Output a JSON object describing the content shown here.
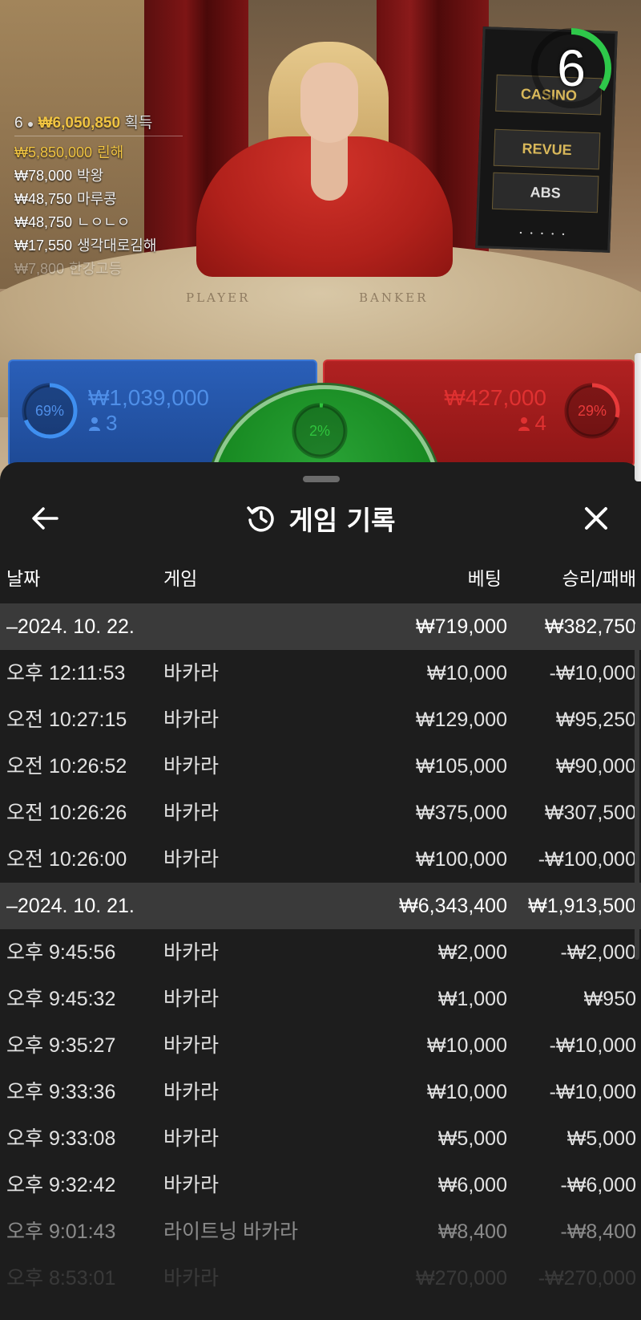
{
  "stream": {
    "timer": "6",
    "table_labels": {
      "player": "PLAYER",
      "banker": "BANKER"
    },
    "sponsors": [
      "CASINO",
      "REVUE",
      "ABS"
    ],
    "sponsor_dots": "• • • • •",
    "winners": {
      "count": "6",
      "total": "₩6,050,850",
      "label": "획득",
      "rows": [
        {
          "amount": "₩5,850,000",
          "name": "린해"
        },
        {
          "amount": "₩78,000",
          "name": "박왕"
        },
        {
          "amount": "₩48,750",
          "name": "마루콩"
        },
        {
          "amount": "₩48,750",
          "name": "ㄴㅇㄴㅇ"
        },
        {
          "amount": "₩17,550",
          "name": "생각대로김해"
        },
        {
          "amount": "₩7,800",
          "name": "한강고등"
        }
      ]
    }
  },
  "bets": {
    "player": {
      "percent": "69%",
      "percent_value": 0.69,
      "amount": "₩1,039,000",
      "players": "3",
      "color": "#2a5fb8"
    },
    "tie": {
      "percent": "2%",
      "percent_value": 0.02,
      "color": "#1c8f27"
    },
    "banker": {
      "percent": "29%",
      "percent_value": 0.29,
      "amount": "₩427,000",
      "players": "4",
      "color": "#b02121"
    }
  },
  "history": {
    "title": "게임 기록",
    "back_icon": "arrow-left-icon",
    "title_icon": "history-icon",
    "close_icon": "close-icon",
    "columns": {
      "date": "날짜",
      "game": "게임",
      "bet": "베팅",
      "result": "승리/패배"
    },
    "rows": [
      {
        "type": "group",
        "date": "–2024. 10. 22.",
        "game": "",
        "bet": "₩719,000",
        "result": "₩382,750"
      },
      {
        "type": "row",
        "date": "오후 12:11:53",
        "game": "바카라",
        "bet": "₩10,000",
        "result": "-₩10,000"
      },
      {
        "type": "row",
        "date": "오전 10:27:15",
        "game": "바카라",
        "bet": "₩129,000",
        "result": "₩95,250"
      },
      {
        "type": "row",
        "date": "오전 10:26:52",
        "game": "바카라",
        "bet": "₩105,000",
        "result": "₩90,000"
      },
      {
        "type": "row",
        "date": "오전 10:26:26",
        "game": "바카라",
        "bet": "₩375,000",
        "result": "₩307,500"
      },
      {
        "type": "row",
        "date": "오전 10:26:00",
        "game": "바카라",
        "bet": "₩100,000",
        "result": "-₩100,000"
      },
      {
        "type": "group",
        "date": "–2024. 10. 21.",
        "game": "",
        "bet": "₩6,343,400",
        "result": "₩1,913,500"
      },
      {
        "type": "row",
        "date": "오후 9:45:56",
        "game": "바카라",
        "bet": "₩2,000",
        "result": "-₩2,000"
      },
      {
        "type": "row",
        "date": "오후 9:45:32",
        "game": "바카라",
        "bet": "₩1,000",
        "result": "₩950"
      },
      {
        "type": "row",
        "date": "오후 9:35:27",
        "game": "바카라",
        "bet": "₩10,000",
        "result": "-₩10,000"
      },
      {
        "type": "row",
        "date": "오후 9:33:36",
        "game": "바카라",
        "bet": "₩10,000",
        "result": "-₩10,000"
      },
      {
        "type": "row",
        "date": "오후 9:33:08",
        "game": "바카라",
        "bet": "₩5,000",
        "result": "₩5,000"
      },
      {
        "type": "row",
        "date": "오후 9:32:42",
        "game": "바카라",
        "bet": "₩6,000",
        "result": "-₩6,000"
      },
      {
        "type": "row",
        "date": "오후 9:01:43",
        "game": "라이트닝 바카라",
        "bet": "₩8,400",
        "result": "-₩8,400"
      },
      {
        "type": "row",
        "date": "오후 8:53:01",
        "game": "바카라",
        "bet": "₩270,000",
        "result": "-₩270,000"
      }
    ]
  }
}
